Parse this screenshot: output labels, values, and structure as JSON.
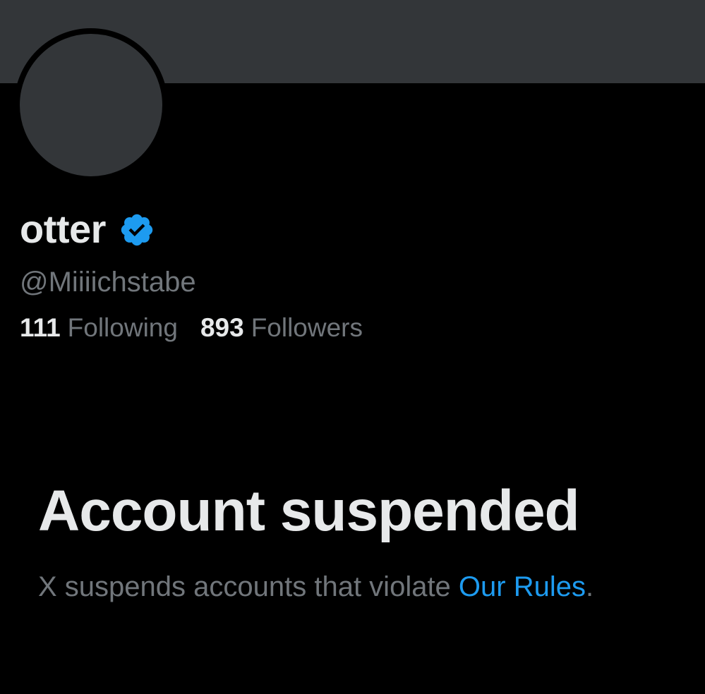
{
  "profile": {
    "display_name": "otter",
    "handle": "@Miiiichstabe",
    "verified": true,
    "following_count": "111",
    "following_label": "Following",
    "followers_count": "893",
    "followers_label": "Followers"
  },
  "suspension": {
    "title": "Account suspended",
    "description": "X suspends accounts that violate ",
    "link_text": "Our Rules",
    "trailing": "."
  },
  "colors": {
    "background": "#000000",
    "banner": "#333639",
    "primary_text": "#e7e9ea",
    "secondary_text": "#71767b",
    "link": "#1d9bf0",
    "verified_badge": "#1d9bf0"
  },
  "icons": {
    "verified": "verified-badge-icon"
  }
}
